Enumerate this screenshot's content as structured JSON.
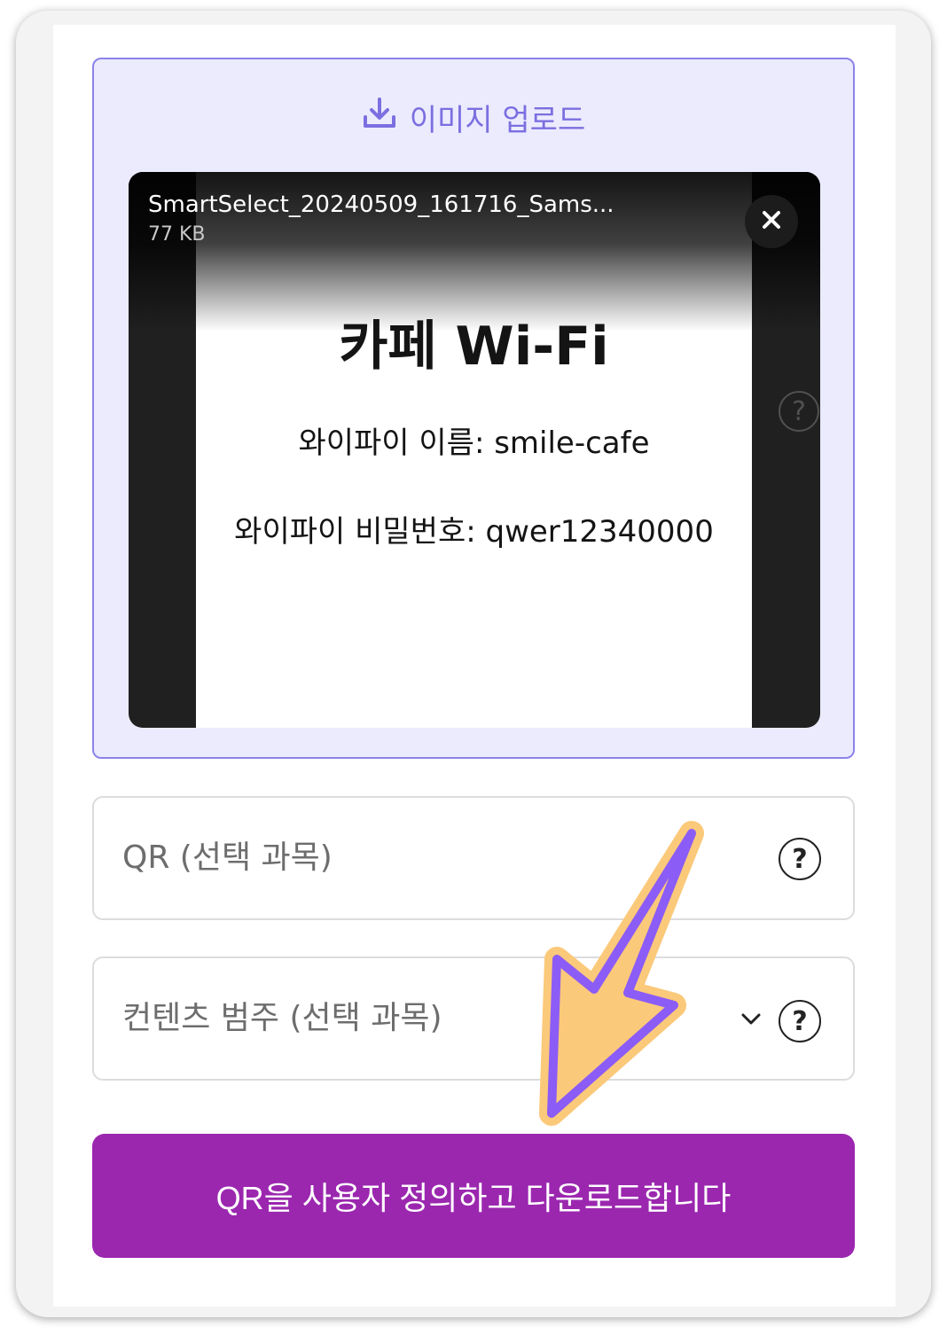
{
  "upload": {
    "label": "이미지 업로드",
    "icon": "download-icon"
  },
  "file": {
    "name": "SmartSelect_20240509_161716_Sams...",
    "size": "77 KB",
    "remove_icon": "close-icon"
  },
  "photo": {
    "title": "카페 Wi-Fi",
    "line1": "와이파이 이름: smile-cafe",
    "line2": "와이파이 비밀번호: qwer12340000"
  },
  "fields": {
    "qr_label": "QR (선택 과목)",
    "category_label": "컨텐츠 범주 (선택 과목)",
    "help_glyph": "?"
  },
  "submit": {
    "label": "QR을 사용자 정의하고 다운로드합니다"
  },
  "colors": {
    "accent": "#9b27af",
    "upload_bg": "#ecebfe",
    "upload_border": "#8b83e8",
    "arrow_fill": "#fbc97a",
    "arrow_stroke": "#8c5cf6"
  }
}
